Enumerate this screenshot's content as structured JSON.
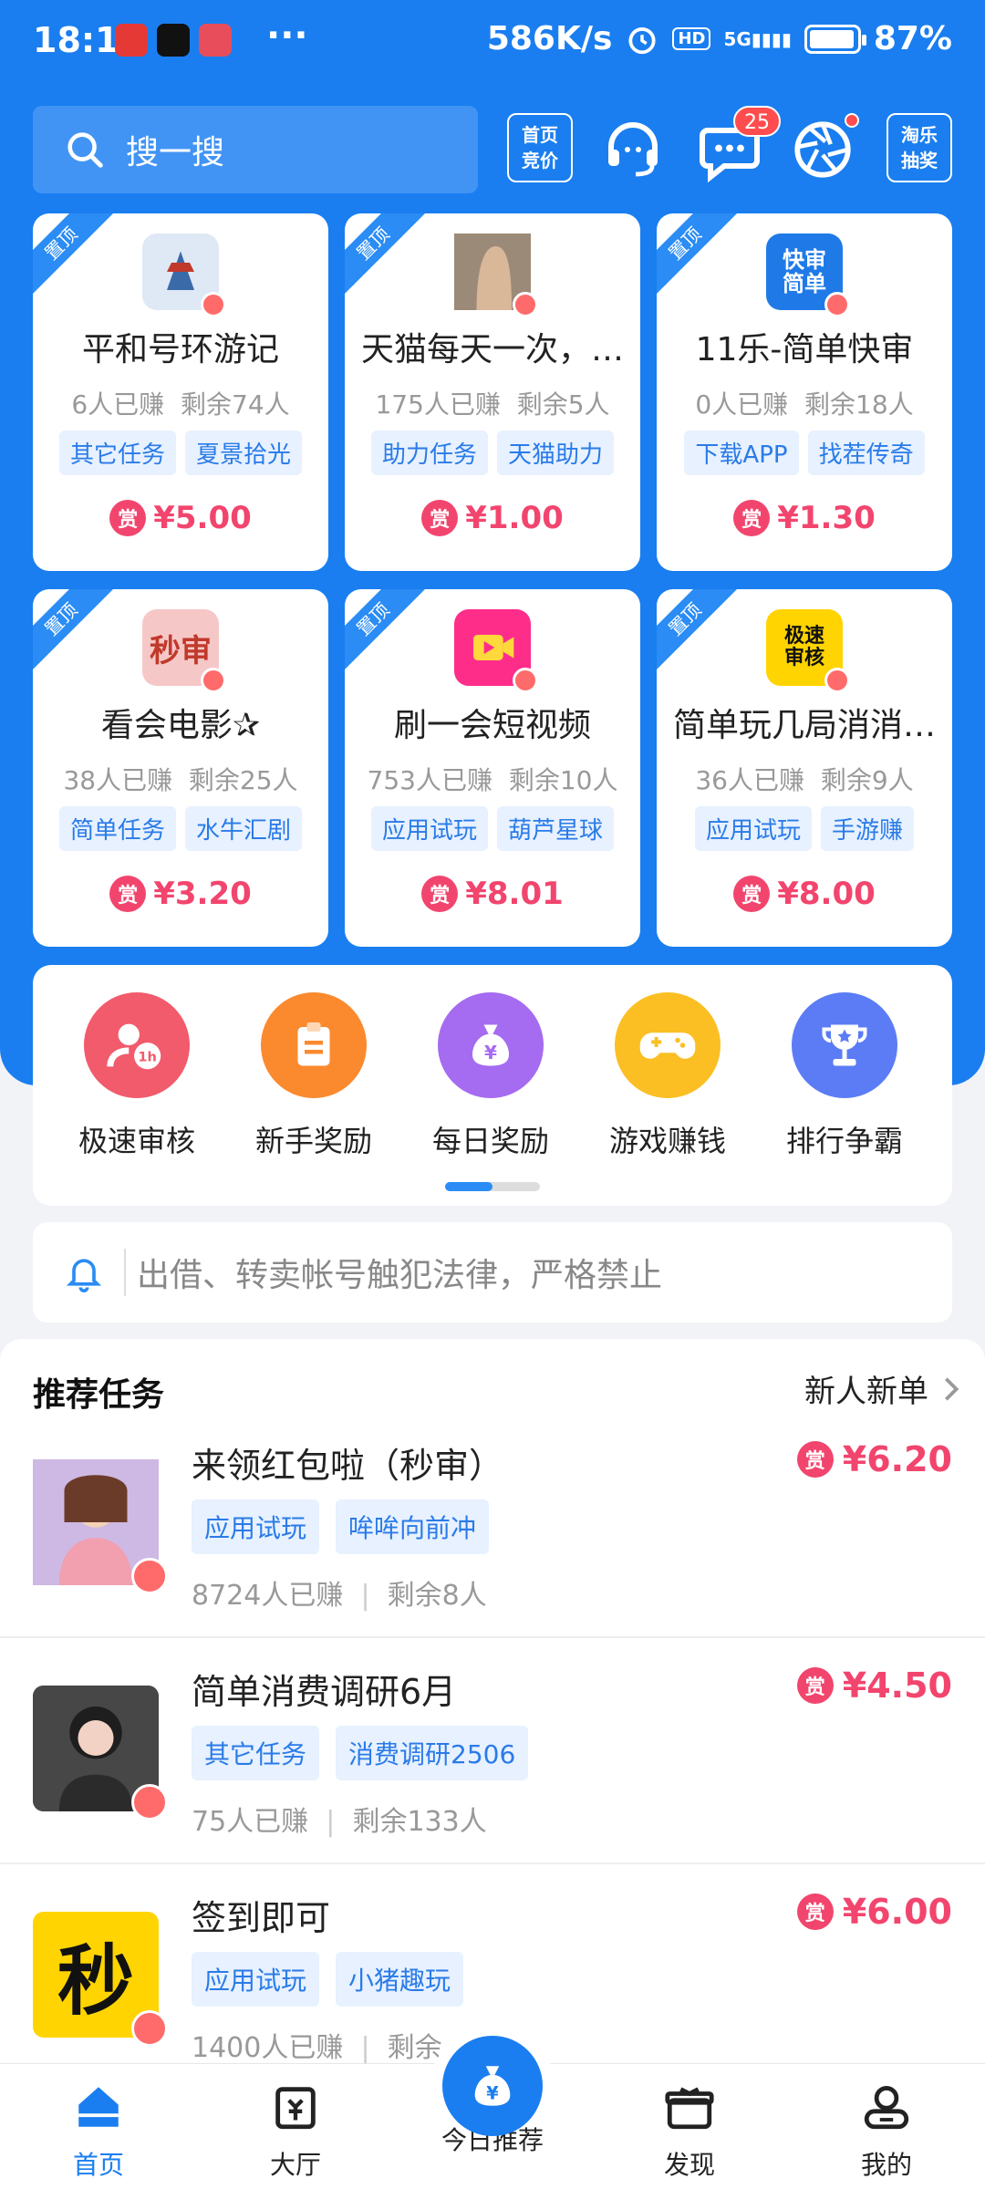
{
  "status_bar": {
    "time": "18:17",
    "network_speed": "586K/s",
    "battery": "87%",
    "network_type": "5G",
    "hd_label": "HD",
    "more_indicator": "···"
  },
  "header": {
    "search_placeholder": "搜一搜",
    "btn_homepage_bid": [
      "首页",
      "竞价"
    ],
    "message_badge": "25",
    "btn_lottery": [
      "淘乐",
      "抽奖"
    ],
    "icons": [
      "search-icon",
      "support-headset-icon",
      "message-icon",
      "camera-aperture-icon"
    ]
  },
  "pin_label": "置顶",
  "reward_symbol": "赏",
  "top_tasks": [
    {
      "title": "平和号环游记",
      "earned": "6人已赚",
      "remaining": "剩余74人",
      "tags": [
        "其它任务",
        "夏景拾光"
      ],
      "price": "¥5.00"
    },
    {
      "title": "天猫每天一次，…",
      "earned": "175人已赚",
      "remaining": "剩余5人",
      "tags": [
        "助力任务",
        "天猫助力"
      ],
      "price": "¥1.00"
    },
    {
      "title": "11乐-简单快审",
      "earned": "0人已赚",
      "remaining": "剩余18人",
      "tags": [
        "下载APP",
        "找茬传奇"
      ],
      "price": "¥1.30",
      "icon_text": "快审简单"
    },
    {
      "title": "看会电影✰",
      "earned": "38人已赚",
      "remaining": "剩余25人",
      "tags": [
        "简单任务",
        "水牛汇剧"
      ],
      "price": "¥3.20",
      "icon_text": "秒审"
    },
    {
      "title": "刷一会短视频",
      "earned": "753人已赚",
      "remaining": "剩余10人",
      "tags": [
        "应用试玩",
        "葫芦星球"
      ],
      "price": "¥8.01"
    },
    {
      "title": "简单玩几局消消…",
      "earned": "36人已赚",
      "remaining": "剩余9人",
      "tags": [
        "应用试玩",
        "手游赚"
      ],
      "price": "¥8.00",
      "icon_text": "极速审核"
    }
  ],
  "quick_menu": [
    {
      "label": "极速审核",
      "color": "#f15b6c",
      "icon": "fast-review-icon"
    },
    {
      "label": "新手奖励",
      "color": "#fb8a2e",
      "icon": "clipboard-icon"
    },
    {
      "label": "每日奖励",
      "color": "#a56bf0",
      "icon": "money-bag-icon"
    },
    {
      "label": "游戏赚钱",
      "color": "#fbbf24",
      "icon": "gamepad-icon"
    },
    {
      "label": "排行争霸",
      "color": "#5b7cf5",
      "icon": "trophy-icon"
    }
  ],
  "notice": {
    "text": "出借、转卖帐号触犯法律，严格禁止"
  },
  "recommended": {
    "title": "推荐任务",
    "more": "新人新单",
    "items": [
      {
        "name": "来领红包啦（秒审）",
        "tags": [
          "应用试玩",
          "哞哞向前冲"
        ],
        "earned": "8724人已赚",
        "remaining": "剩余8人",
        "price": "¥6.20"
      },
      {
        "name": "简单消费调研6月",
        "tags": [
          "其它任务",
          "消费调研2506"
        ],
        "earned": "75人已赚",
        "remaining": "剩余133人",
        "price": "¥4.50"
      },
      {
        "name": "签到即可",
        "tags": [
          "应用试玩",
          "小猪趣玩"
        ],
        "earned": "1400人已赚",
        "remaining": "剩余…",
        "price": "¥6.00",
        "icon_text": "秒"
      }
    ],
    "stat_separator": "|"
  },
  "bottom_nav": [
    {
      "label": "首页",
      "active": true
    },
    {
      "label": "大厅",
      "active": false
    },
    {
      "label": "今日推荐",
      "active": false
    },
    {
      "label": "发现",
      "active": false
    },
    {
      "label": "我的",
      "active": false
    }
  ],
  "colors": {
    "primary": "#1a7ef0",
    "price": "#f2456e",
    "tag_bg": "#e7f1ff",
    "tag_text": "#2a7be8"
  }
}
